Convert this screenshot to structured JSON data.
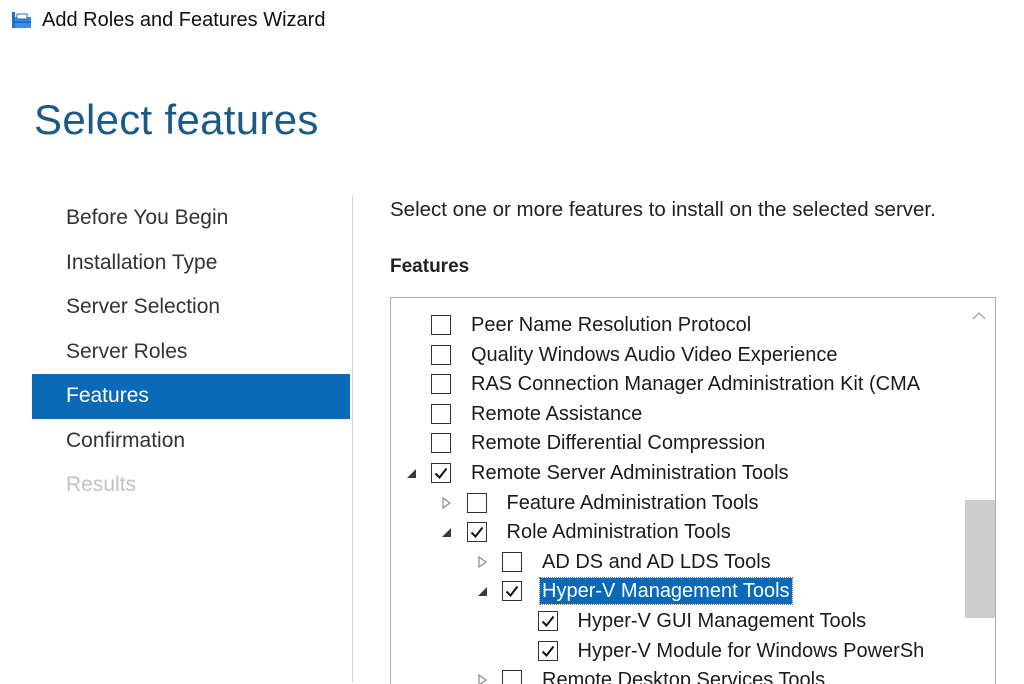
{
  "window": {
    "title": "Add Roles and Features Wizard",
    "icon": "wizard-app-icon"
  },
  "page": {
    "title": "Select features",
    "instruction": "Select one or more features to install on the selected server.",
    "features_label": "Features"
  },
  "nav": {
    "items": [
      {
        "label": "Before You Begin",
        "state": "normal"
      },
      {
        "label": "Installation Type",
        "state": "normal"
      },
      {
        "label": "Server Selection",
        "state": "normal"
      },
      {
        "label": "Server Roles",
        "state": "normal"
      },
      {
        "label": "Features",
        "state": "active"
      },
      {
        "label": "Confirmation",
        "state": "normal"
      },
      {
        "label": "Results",
        "state": "disabled"
      }
    ]
  },
  "features": {
    "items": [
      {
        "label": "Peer Name Resolution Protocol",
        "level": 0,
        "checked": false,
        "expander": "none",
        "selected": false
      },
      {
        "label": "Quality Windows Audio Video Experience",
        "level": 0,
        "checked": false,
        "expander": "none",
        "selected": false
      },
      {
        "label": "RAS Connection Manager Administration Kit (CMA",
        "level": 0,
        "checked": false,
        "expander": "none",
        "selected": false
      },
      {
        "label": "Remote Assistance",
        "level": 0,
        "checked": false,
        "expander": "none",
        "selected": false
      },
      {
        "label": "Remote Differential Compression",
        "level": 0,
        "checked": false,
        "expander": "none",
        "selected": false
      },
      {
        "label": "Remote Server Administration Tools",
        "level": 0,
        "checked": true,
        "expander": "expanded",
        "selected": false
      },
      {
        "label": "Feature Administration Tools",
        "level": 1,
        "checked": false,
        "expander": "collapsed",
        "selected": false
      },
      {
        "label": "Role Administration Tools",
        "level": 1,
        "checked": true,
        "expander": "expanded",
        "selected": false
      },
      {
        "label": "AD DS and AD LDS Tools",
        "level": 2,
        "checked": false,
        "expander": "collapsed",
        "selected": false
      },
      {
        "label": "Hyper-V Management Tools",
        "level": 2,
        "checked": true,
        "expander": "expanded",
        "selected": true
      },
      {
        "label": "Hyper-V GUI Management Tools",
        "level": 3,
        "checked": true,
        "expander": "none",
        "selected": false
      },
      {
        "label": "Hyper-V Module for Windows PowerSh",
        "level": 3,
        "checked": true,
        "expander": "none",
        "selected": false
      },
      {
        "label": "Remote Desktop Services Tools",
        "level": 2,
        "checked": false,
        "expander": "collapsed",
        "selected": false
      }
    ]
  },
  "colors": {
    "accent": "#0a6ab8",
    "title": "#1c5a86",
    "disabled": "#c2c2c2"
  }
}
